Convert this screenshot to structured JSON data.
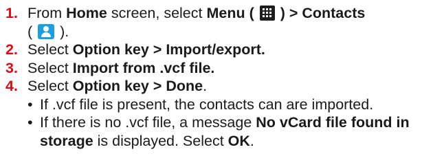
{
  "steps": [
    {
      "num": "1.",
      "parts": [
        "From ",
        "Home",
        " screen, select ",
        "Menu",
        " ( ",
        " ) > Contacts",
        "( ",
        " )."
      ]
    },
    {
      "num": "2.",
      "parts": [
        "Select ",
        "Option key > Import/export."
      ]
    },
    {
      "num": "3.",
      "parts": [
        "Select ",
        "Import from .vcf file."
      ]
    },
    {
      "num": "4.",
      "parts": [
        "Select ",
        "Option key > Done",
        "."
      ]
    }
  ],
  "bullets": [
    {
      "dot": "•",
      "parts": [
        "If .vcf file is present, the contacts can are imported."
      ]
    },
    {
      "dot": "•",
      "parts": [
        "If there is no .vcf file, a message ",
        "No vCard file found in storage",
        " is displayed. Select ",
        "OK",
        "."
      ]
    }
  ],
  "icons": {
    "menu": "menu-grid-icon",
    "contacts": "contacts-person-icon"
  },
  "colors": {
    "step_number": "#e30613",
    "menu_icon_bg": "#1e1e1e",
    "contacts_icon_bg": "#1b9fe0"
  }
}
